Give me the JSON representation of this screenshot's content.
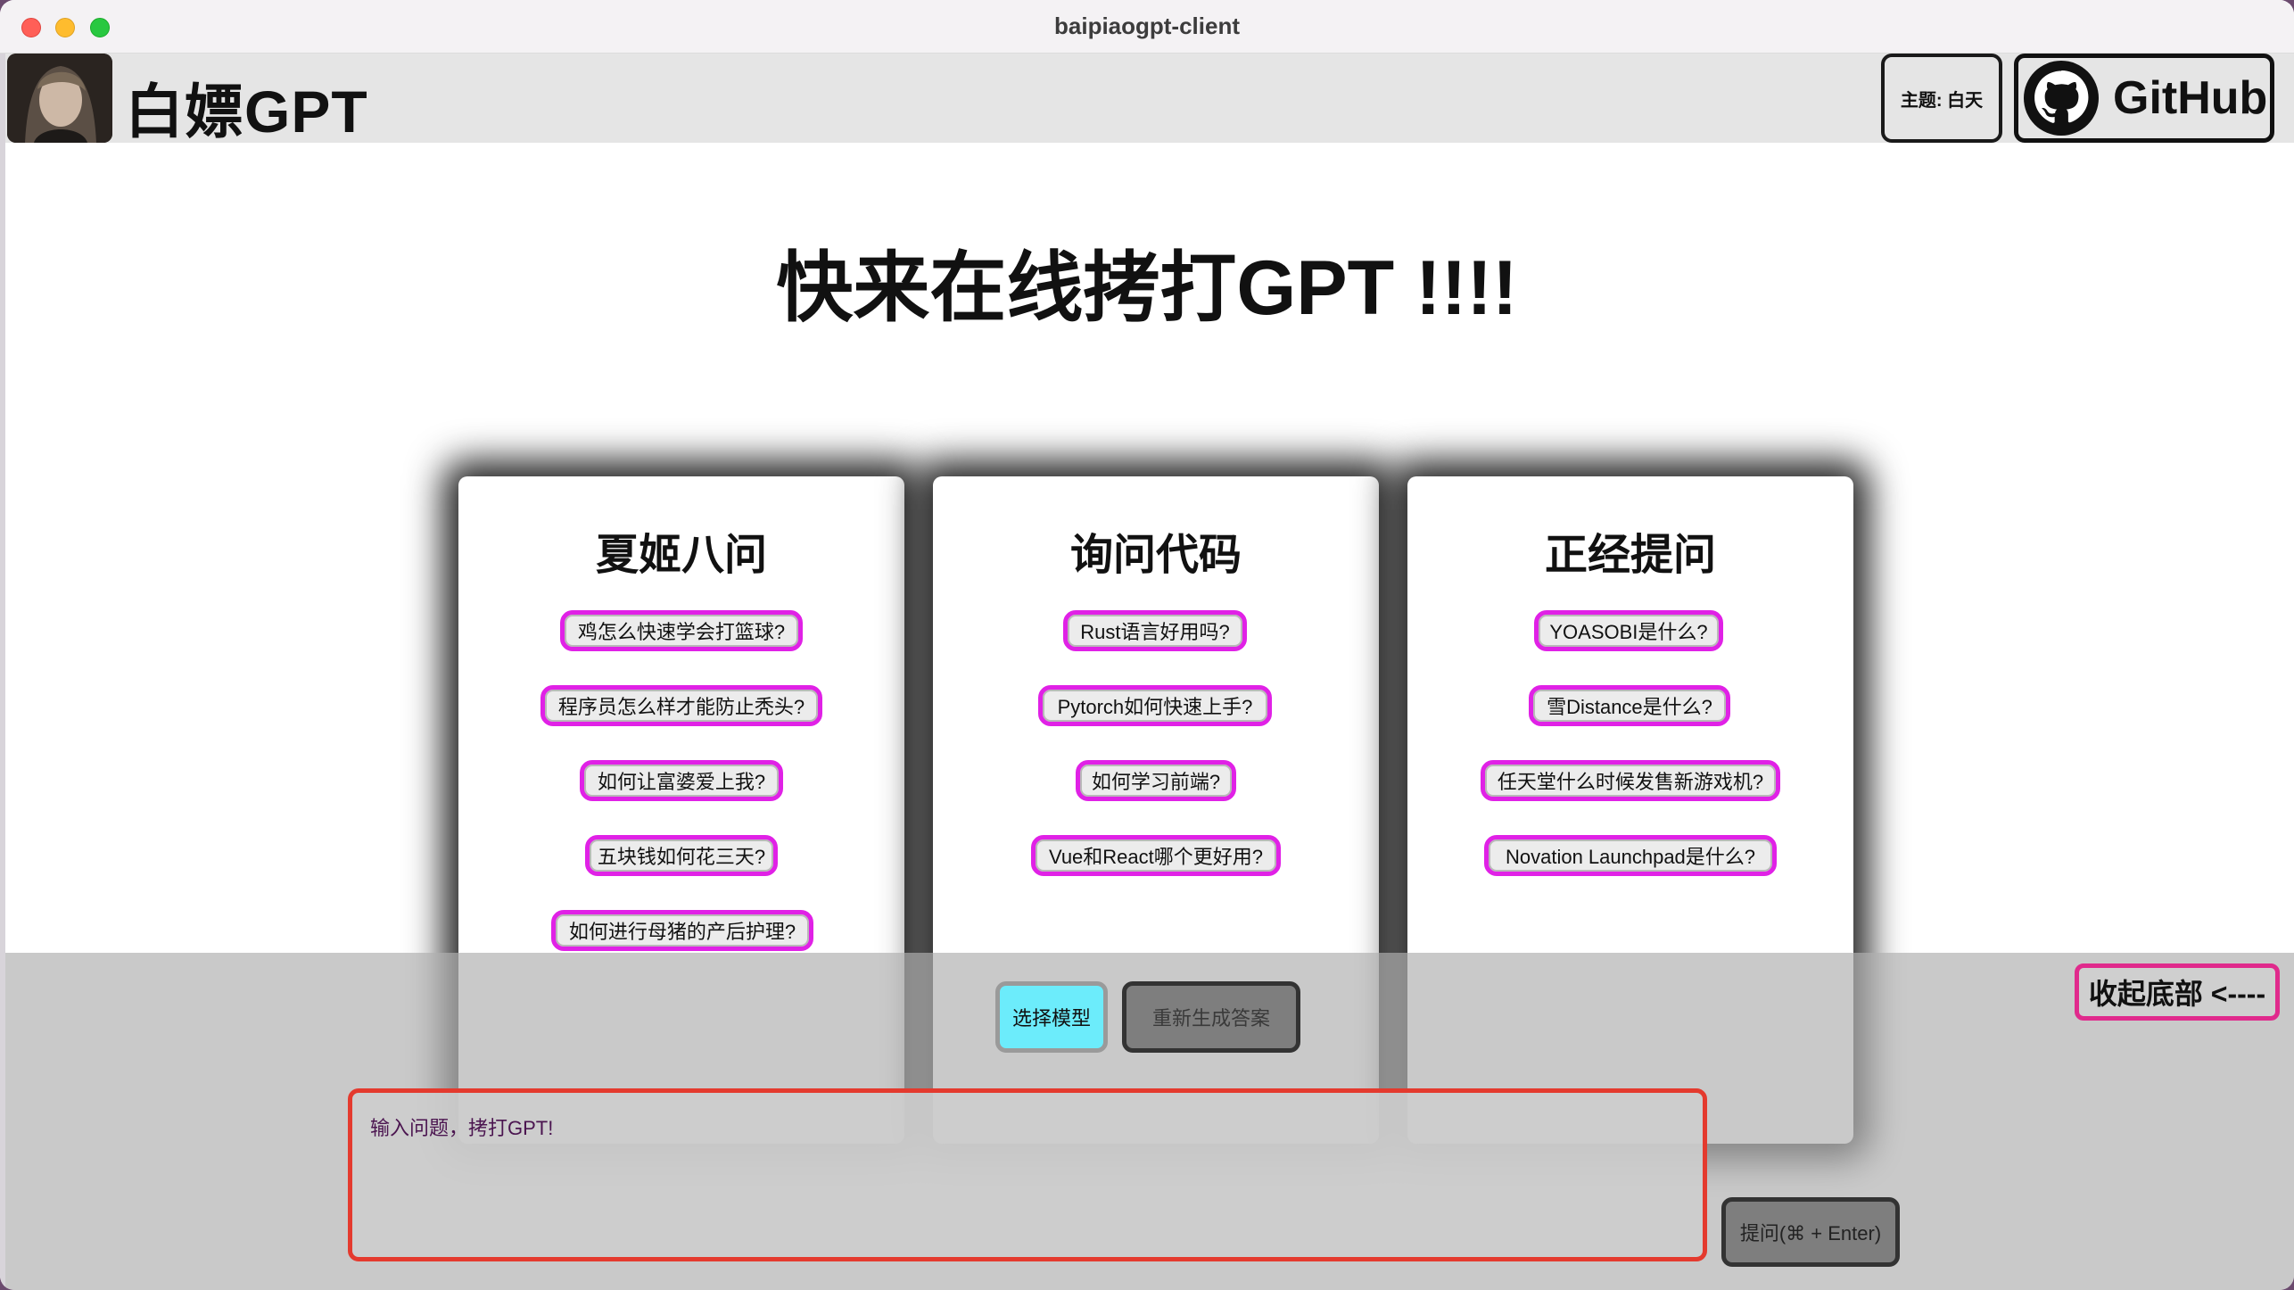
{
  "window": {
    "title": "baipiaogpt-client"
  },
  "header": {
    "app_name": "白嫖GPT",
    "theme_label": "主题: 白天",
    "github_label": "GitHub"
  },
  "hero": {
    "title": "快来在线拷打GPT !!!!"
  },
  "cards": [
    {
      "title": "夏姬八问",
      "questions": [
        "鸡怎么快速学会打篮球?",
        "程序员怎么样才能防止秃头?",
        "如何让富婆爱上我?",
        "五块钱如何花三天?",
        "如何进行母猪的产后护理?"
      ]
    },
    {
      "title": "询问代码",
      "questions": [
        "Rust语言好用吗?",
        "Pytorch如何快速上手?",
        "如何学习前端?",
        "Vue和React哪个更好用?"
      ]
    },
    {
      "title": "正经提问",
      "questions": [
        "YOASOBI是什么?",
        "雪Distance是什么?",
        "任天堂什么时候发售新游戏机?",
        "Novation Launchpad是什么?"
      ]
    }
  ],
  "bottom": {
    "select_model_label": "选择模型",
    "regenerate_label": "重新生成答案",
    "collapse_label": "收起底部 <----",
    "input_placeholder": "输入问题，拷打GPT!",
    "ask_label": "提问(⌘ + Enter)"
  },
  "colors": {
    "chip_border": "#e021e6",
    "select_model_bg": "#6cecfb",
    "input_border": "#e43a2e",
    "collapse_border": "#e02a8c"
  }
}
